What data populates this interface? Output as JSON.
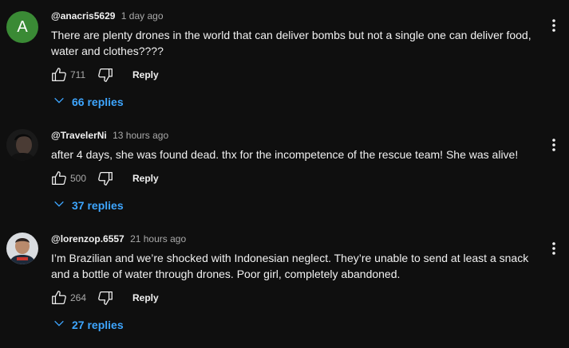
{
  "comments": [
    {
      "avatar_letter": "A",
      "avatar_color": "#3a8a35",
      "handle": "@anacris5629",
      "time": "1 day ago",
      "text": "There are plenty drones in the world that can deliver bombs but not a single one can deliver food, water and clothes????",
      "likes": "711",
      "reply_label": "Reply",
      "replies_label": "66 replies"
    },
    {
      "handle": "@TravelerNi",
      "time": "13 hours ago",
      "text": "after 4 days, she was found dead. thx for the incompetence of the rescue team! She was alive!",
      "likes": "500",
      "reply_label": "Reply",
      "replies_label": "37 replies"
    },
    {
      "handle": "@lorenzop.6557",
      "time": "21 hours ago",
      "text": "I’m Brazilian and we’re shocked with Indonesian neglect. They’re unable to send at least a snack and a bottle of water through drones. Poor girl, completely abandoned.",
      "likes": "264",
      "reply_label": "Reply",
      "replies_label": "27 replies"
    }
  ],
  "colors": {
    "background": "#0f0f0f",
    "text": "#f1f1f1",
    "secondary": "#aaaaaa",
    "link": "#3ea6ff"
  },
  "icons": {
    "like": "thumbs-up-icon",
    "dislike": "thumbs-down-icon",
    "replies": "chevron-down-icon",
    "menu": "more-vertical-icon"
  }
}
